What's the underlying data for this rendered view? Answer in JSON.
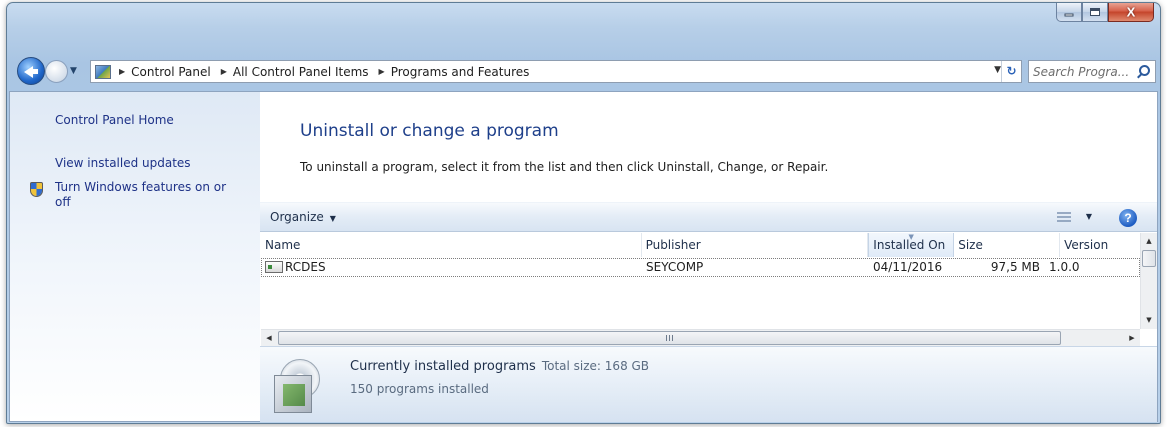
{
  "window": {
    "minimize_label": "",
    "maximize_label": "",
    "close_label": "X"
  },
  "navbar": {
    "breadcrumbs": [
      "Control Panel",
      "All Control Panel Items",
      "Programs and Features"
    ],
    "search_placeholder": "Search Progra..."
  },
  "sidebar": {
    "items": [
      {
        "label": "Control Panel Home"
      },
      {
        "label": "View installed updates"
      },
      {
        "label": "Turn Windows features on or off"
      }
    ]
  },
  "main": {
    "title": "Uninstall or change a program",
    "description": "To uninstall a program, select it from the list and then click Uninstall, Change, or Repair.",
    "toolbar": {
      "organize_label": "Organize"
    },
    "columns": [
      "Name",
      "Publisher",
      "Installed On",
      "Size",
      "Version"
    ],
    "rows": [
      {
        "name": "RCDES",
        "publisher": "SEYCOMP",
        "installed_on": "04/11/2016",
        "size": "97,5 MB",
        "version": "1.0.0"
      }
    ]
  },
  "details": {
    "title": "Currently installed programs",
    "total_size_label": "Total size: 168 GB",
    "count": "150 programs installed"
  },
  "icons": [
    "back-icon",
    "forward-icon",
    "control-panel-icon",
    "refresh-icon",
    "search-icon",
    "shield-icon",
    "views-icon",
    "help-icon",
    "program-icon",
    "installer-box-icon"
  ]
}
